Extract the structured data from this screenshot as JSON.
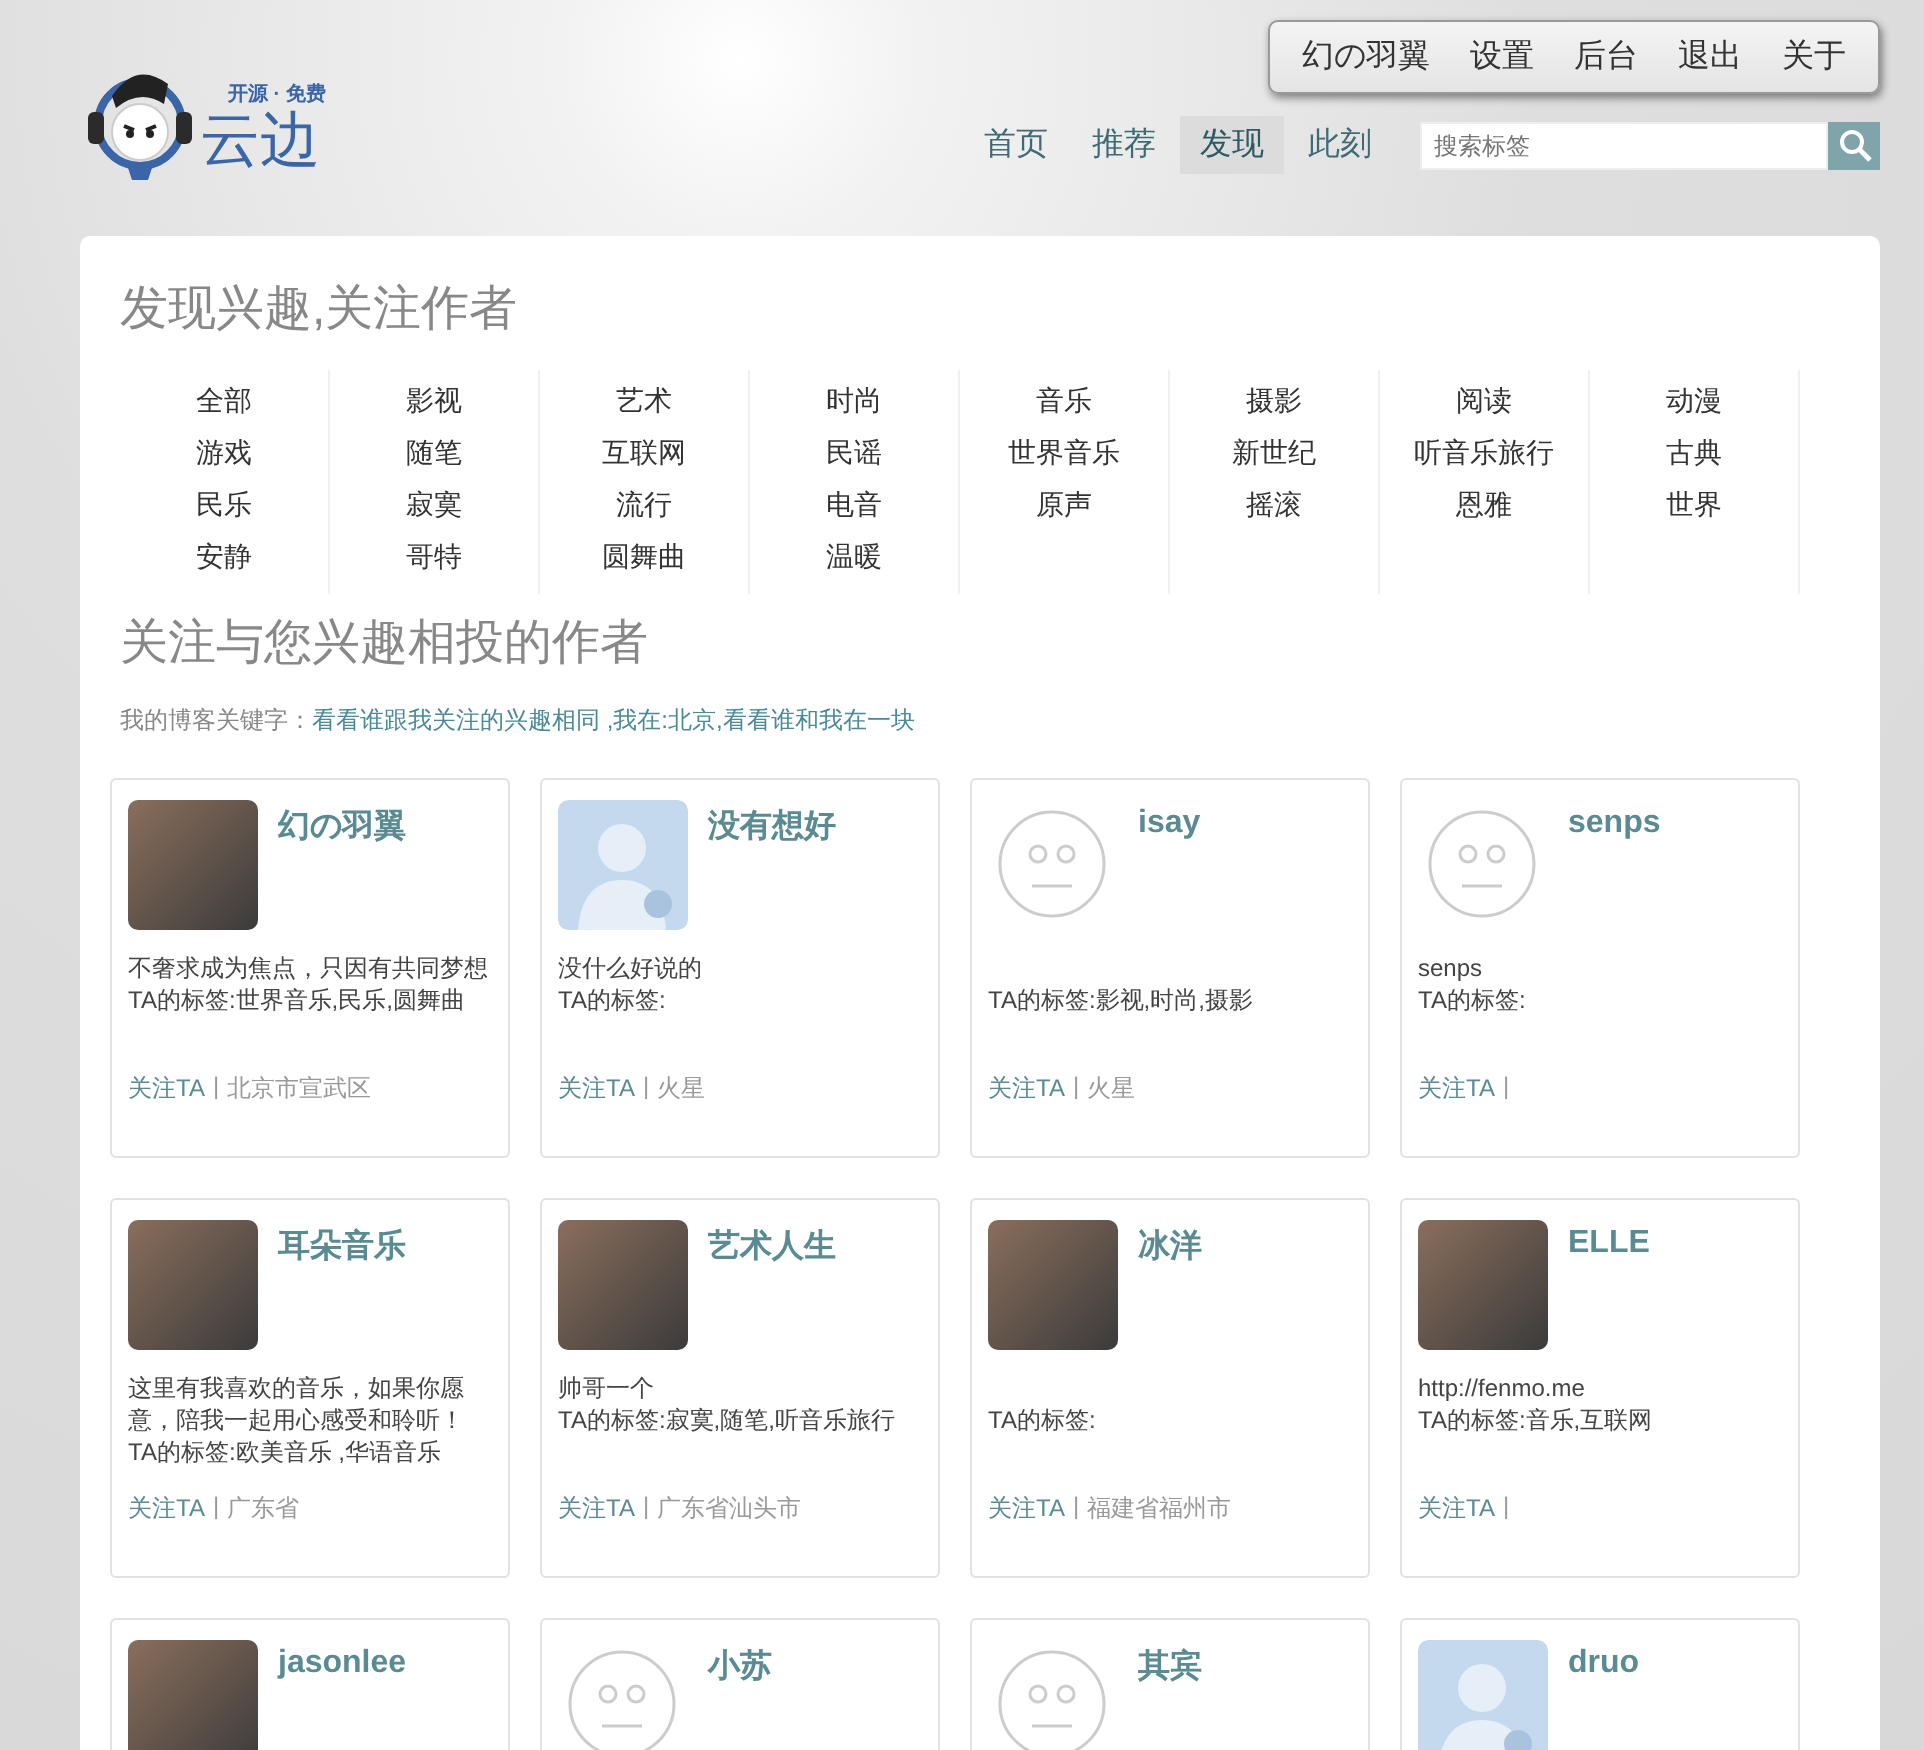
{
  "logo": {
    "tagline": "开源 · 免费",
    "name": "云边"
  },
  "user_menu": [
    "幻の羽翼",
    "设置",
    "后台",
    "退出",
    "关于"
  ],
  "nav": [
    {
      "label": "首页",
      "selected": false
    },
    {
      "label": "推荐",
      "selected": false
    },
    {
      "label": "发现",
      "selected": true
    },
    {
      "label": "此刻",
      "selected": false
    }
  ],
  "search": {
    "placeholder": "搜索标签"
  },
  "interests": {
    "title": "发现兴趣,关注作者",
    "columns": [
      [
        "全部",
        "游戏",
        "民乐",
        "安静"
      ],
      [
        "影视",
        "随笔",
        "寂寞",
        "哥特"
      ],
      [
        "艺术",
        "互联网",
        "流行",
        "圆舞曲"
      ],
      [
        "时尚",
        "民谣",
        "电音",
        "温暖"
      ],
      [
        "音乐",
        "世界音乐",
        "原声"
      ],
      [
        "摄影",
        "新世纪",
        "摇滚"
      ],
      [
        "阅读",
        "听音乐旅行",
        "恩雅"
      ],
      [
        "动漫",
        "古典",
        "世界"
      ]
    ]
  },
  "authors": {
    "title": "关注与您兴趣相投的作者",
    "keyword_label": "我的博客关键字：",
    "keyword_link": "看看谁跟我关注的兴趣相同 ,我在:北京,看看谁和我在一块",
    "cards": [
      {
        "name": "幻の羽翼",
        "kind": "photo",
        "description": " 不奢求成为焦点，只因有共同梦想",
        "tags": "TA的标签:世界音乐,民乐,圆舞曲",
        "follow": "关注TA",
        "separator": "|",
        "location": "北京市宣武区"
      },
      {
        "name": "没有想好",
        "kind": "silhouette",
        "description": "没什么好说的",
        "tags": "TA的标签:",
        "follow": "关注TA",
        "separator": "|",
        "location": "火星"
      },
      {
        "name": "isay",
        "kind": "face",
        "tags": "TA的标签:影视,时尚,摄影",
        "follow": "关注TA",
        "separator": "|",
        "location": "火星"
      },
      {
        "name": "senps",
        "kind": "face",
        "description": "senps",
        "tags": "TA的标签:",
        "follow": "关注TA",
        "separator": "|"
      },
      {
        "name": "耳朵音乐",
        "kind": "photo",
        "description": "这里有我喜欢的音乐，如果你愿意，陪我一起用心感受和聆听！",
        "tags": "TA的标签:欧美音乐 ,华语音乐",
        "follow": "关注TA",
        "separator": "|",
        "location": "广东省"
      },
      {
        "name": "艺术人生",
        "kind": "photo",
        "description": "帅哥一个",
        "tags": "TA的标签:寂寞,随笔,听音乐旅行",
        "follow": "关注TA",
        "separator": "|",
        "location": "广东省汕头市"
      },
      {
        "name": "冰洋",
        "kind": "photo",
        "tags": "TA的标签:",
        "follow": "关注TA",
        "separator": "|",
        "location": "福建省福州市"
      },
      {
        "name": "ELLE",
        "kind": "photo",
        "description": "http://fenmo.me",
        "tags": "TA的标签:音乐,互联网",
        "follow": "关注TA",
        "separator": "|"
      },
      {
        "name": "jasonlee",
        "kind": "photo"
      },
      {
        "name": "小苏",
        "kind": "face"
      },
      {
        "name": "其宾",
        "kind": "face"
      },
      {
        "name": "druo",
        "kind": "silhouette"
      }
    ]
  }
}
